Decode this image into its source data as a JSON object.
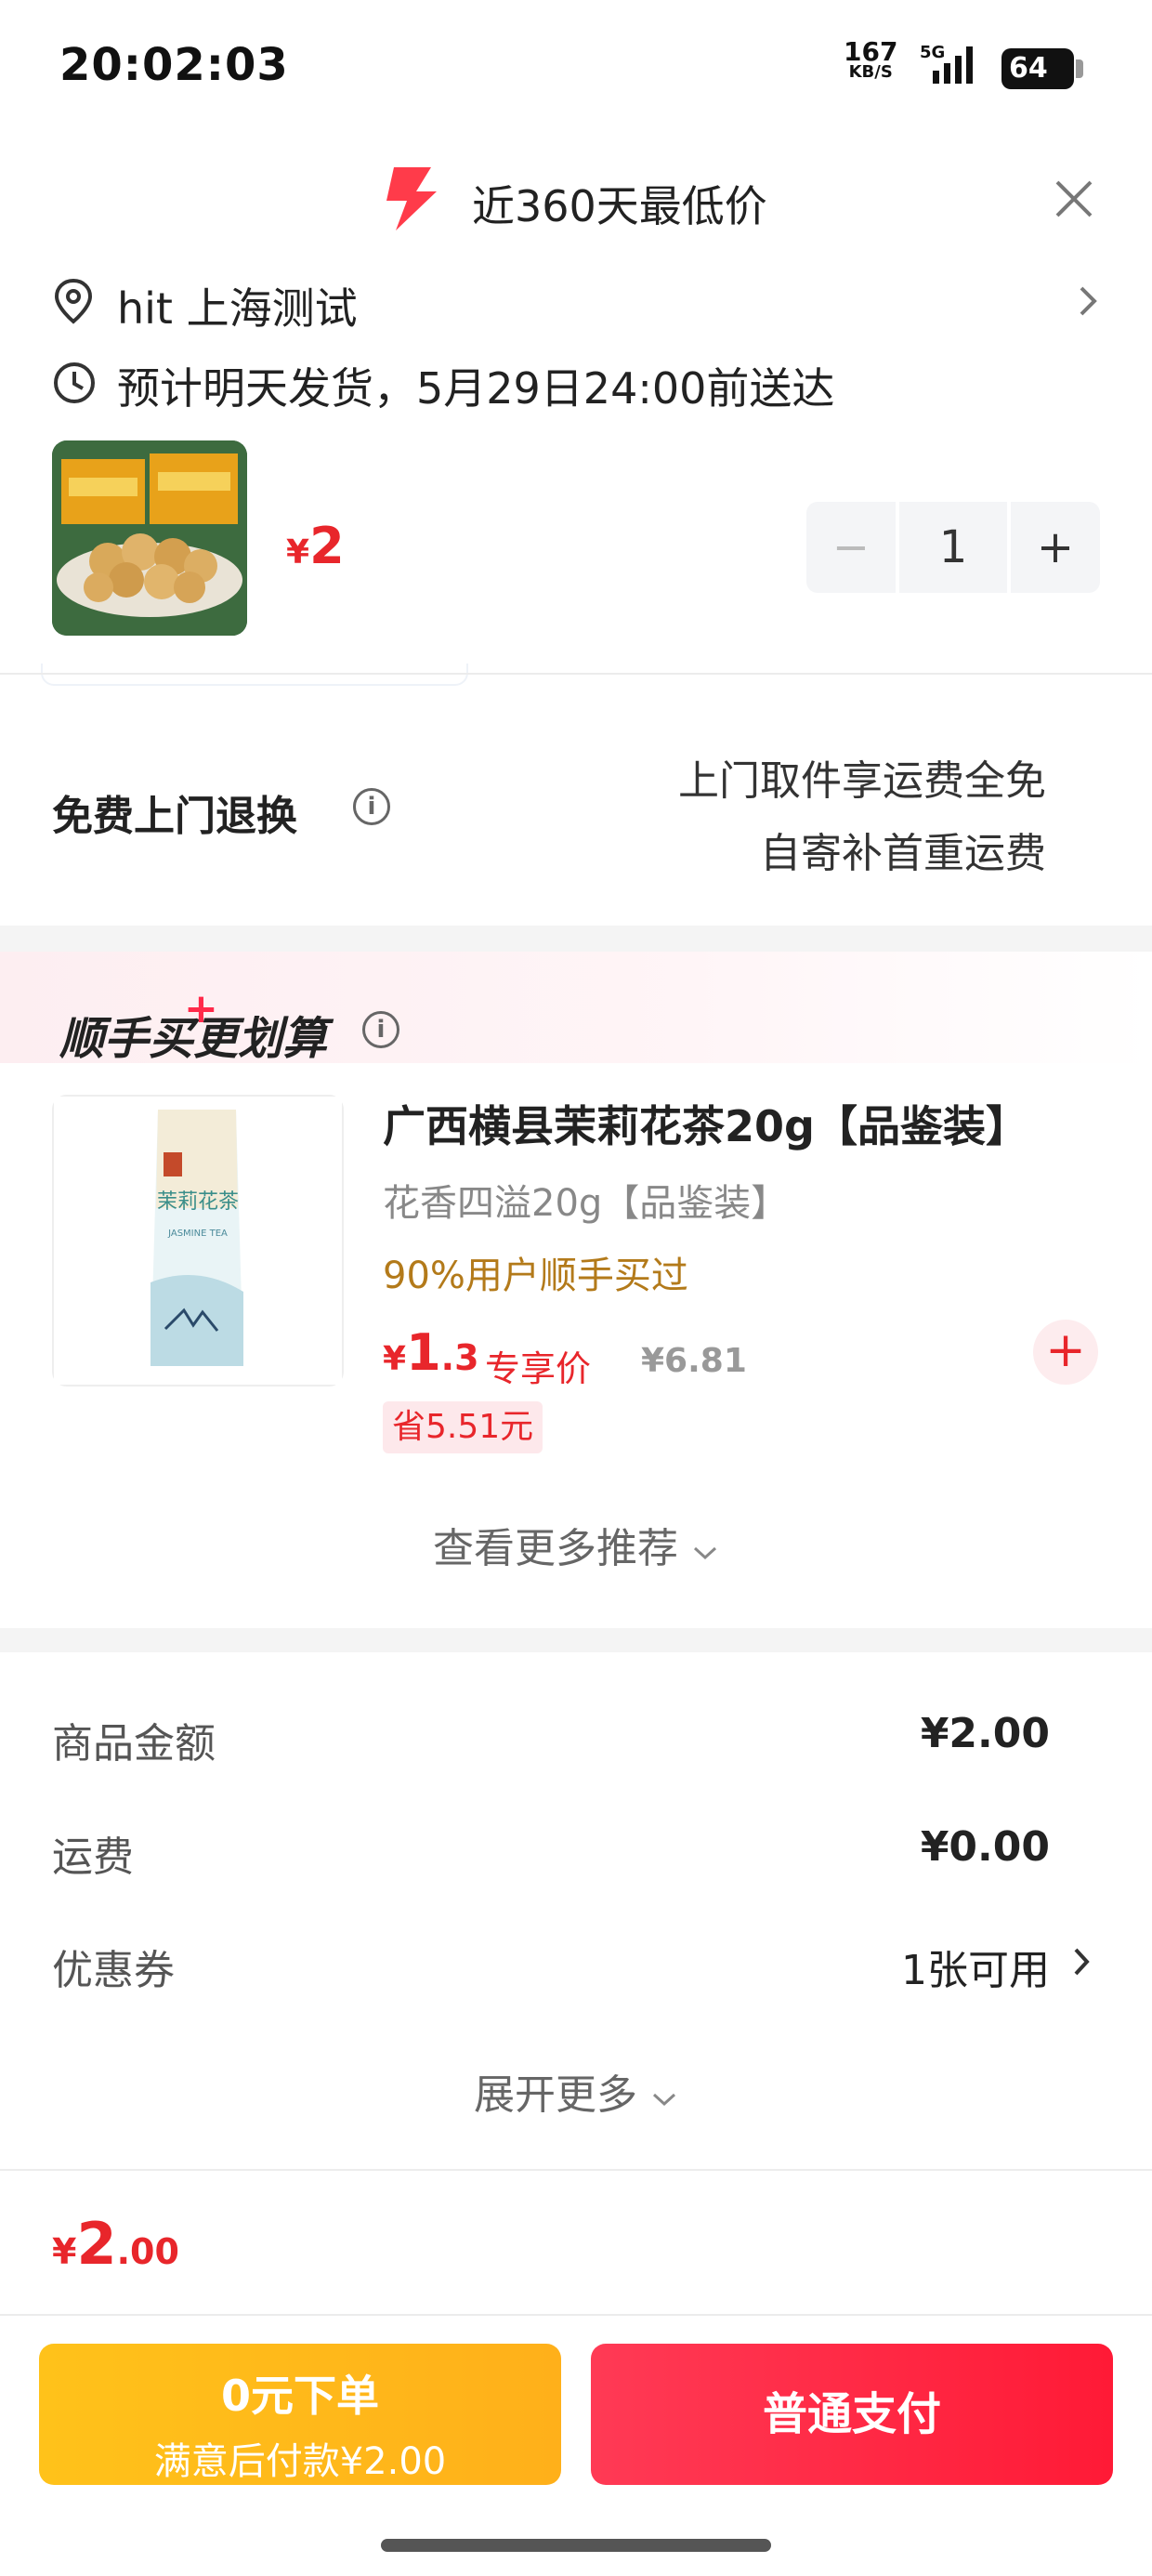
{
  "status_bar": {
    "time": "20:02:03",
    "speed_value": "167",
    "speed_unit": "KB/S",
    "network": "5G",
    "battery": "64"
  },
  "banner": {
    "text": "近360天最低价",
    "icon": "lightning-icon"
  },
  "address": {
    "text": "hit  上海测试"
  },
  "delivery": {
    "text": "预计明天发货，5月29日24:00前送达"
  },
  "product": {
    "currency": "¥",
    "price": "2",
    "quantity": "1",
    "minus": "−",
    "plus": "+"
  },
  "free_return": {
    "title": "免费上门退换",
    "line1": "上门取件享运费全免",
    "line2": "自寄补首重运费"
  },
  "recommend": {
    "title_a": "顺手买",
    "title_b": "更划算",
    "item": {
      "name": "广西横县茉莉花茶20g【品鉴装】",
      "sub": "花香四溢20g【品鉴装】",
      "users": "90%用户顺手买过",
      "currency": "¥",
      "price_int": "1",
      "price_dec": ".3",
      "price_label": "专享价",
      "orig_price": "¥6.81",
      "save": "省5.51元",
      "add": "+",
      "pack_text": "茉莉花茶",
      "pack_sub": "JASMINE TEA"
    },
    "more": "查看更多推荐"
  },
  "fees": [
    {
      "label": "商品金额",
      "value": "¥2.00"
    },
    {
      "label": "运费",
      "value": "¥0.00"
    },
    {
      "label": "优惠券",
      "value": "1张可用"
    }
  ],
  "expand": "展开更多",
  "total": {
    "currency": "¥",
    "int": "2",
    "dec": ".00"
  },
  "buttons": {
    "zero_title": "0元下单",
    "zero_sub": "满意后付款¥2.00",
    "pay": "普通支付"
  },
  "colors": {
    "accent_red": "#e8262b",
    "yellow_btn": "#ffb91a",
    "red_btn": "#ff2a45"
  }
}
